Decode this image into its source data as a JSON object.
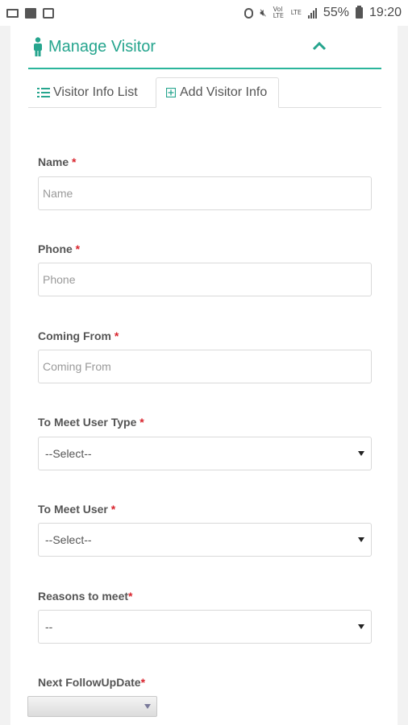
{
  "status_bar": {
    "left_icons": [
      "screen-icon",
      "gallery-icon",
      "message-icon"
    ],
    "vol_label": "Vol LTE",
    "lte_label": "LTE",
    "battery_percent": "55%",
    "time": "19:20"
  },
  "header": {
    "title": "Manage Visitor",
    "accent_color": "#26a58e"
  },
  "tabs": [
    {
      "label": "Visitor Info List",
      "active": false
    },
    {
      "label": "Add Visitor Info",
      "active": true
    }
  ],
  "form": {
    "name": {
      "label": "Name",
      "required": "*",
      "placeholder": "Name",
      "value": ""
    },
    "phone": {
      "label": "Phone",
      "required": "*",
      "placeholder": "Phone",
      "value": ""
    },
    "coming_from": {
      "label": "Coming From",
      "required": "*",
      "placeholder": "Coming From",
      "value": ""
    },
    "to_meet_user_type": {
      "label": "To Meet User Type",
      "required": "*",
      "selected": "--Select--"
    },
    "to_meet_user": {
      "label": "To Meet User",
      "required": "*",
      "selected": "--Select--"
    },
    "reasons_to_meet": {
      "label": "Reasons to meet",
      "required": "*",
      "selected": "--"
    },
    "next_followup_date": {
      "label": "Next FollowUpDate",
      "required": "*",
      "selected": ""
    }
  }
}
